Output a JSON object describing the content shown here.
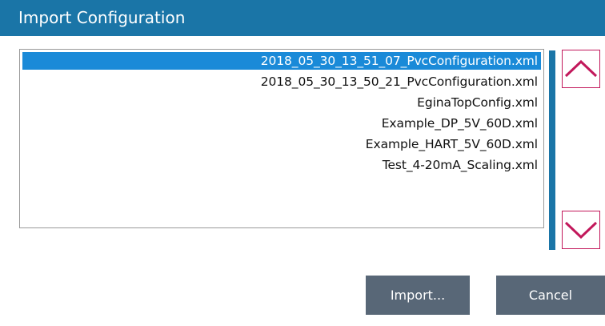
{
  "dialog": {
    "title": "Import Configuration"
  },
  "files": [
    {
      "name": "2018_05_30_13_51_07_PvcConfiguration.xml",
      "selected": true
    },
    {
      "name": "2018_05_30_13_50_21_PvcConfiguration.xml",
      "selected": false
    },
    {
      "name": "EginaTopConfig.xml",
      "selected": false
    },
    {
      "name": "Example_DP_5V_60D.xml",
      "selected": false
    },
    {
      "name": "Example_HART_5V_60D.xml",
      "selected": false
    },
    {
      "name": "Test_4-20mA_Scaling.xml",
      "selected": false
    }
  ],
  "scroll": {
    "up_icon": "chevron-up-icon",
    "down_icon": "chevron-down-icon"
  },
  "buttons": {
    "import_label": "Import...",
    "cancel_label": "Cancel"
  },
  "colors": {
    "titlebar": "#1a75a7",
    "selection": "#1a8ad8",
    "scroll_arrow": "#c2185b",
    "button": "#586777"
  }
}
